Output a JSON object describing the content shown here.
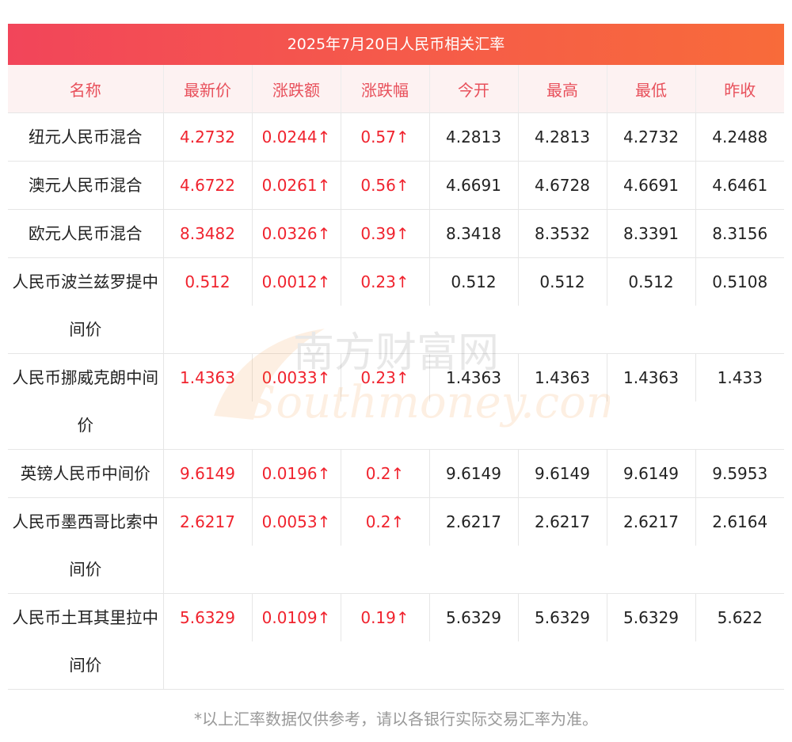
{
  "title": "2025年7月20日人民币相关汇率",
  "headers": [
    "名称",
    "最新价",
    "涨跌额",
    "涨跌幅",
    "今开",
    "最高",
    "最低",
    "昨收"
  ],
  "rows": [
    {
      "name": "纽元人民币混合",
      "latest": "4.2732",
      "change": "0.0244↑",
      "pct": "0.57↑",
      "open": "4.2813",
      "high": "4.2813",
      "low": "4.2732",
      "prev": "4.2488"
    },
    {
      "name": "澳元人民币混合",
      "latest": "4.6722",
      "change": "0.0261↑",
      "pct": "0.56↑",
      "open": "4.6691",
      "high": "4.6728",
      "low": "4.6691",
      "prev": "4.6461"
    },
    {
      "name": "欧元人民币混合",
      "latest": "8.3482",
      "change": "0.0326↑",
      "pct": "0.39↑",
      "open": "8.3418",
      "high": "8.3532",
      "low": "8.3391",
      "prev": "8.3156"
    },
    {
      "name": "人民币波兰兹罗提中间价",
      "latest": "0.512",
      "change": "0.0012↑",
      "pct": "0.23↑",
      "open": "0.512",
      "high": "0.512",
      "low": "0.512",
      "prev": "0.5108"
    },
    {
      "name": "人民币挪威克朗中间价",
      "latest": "1.4363",
      "change": "0.0033↑",
      "pct": "0.23↑",
      "open": "1.4363",
      "high": "1.4363",
      "low": "1.4363",
      "prev": "1.433"
    },
    {
      "name": "英镑人民币中间价",
      "latest": "9.6149",
      "change": "0.0196↑",
      "pct": "0.2↑",
      "open": "9.6149",
      "high": "9.6149",
      "low": "9.6149",
      "prev": "9.5953"
    },
    {
      "name": "人民币墨西哥比索中间价",
      "latest": "2.6217",
      "change": "0.0053↑",
      "pct": "0.2↑",
      "open": "2.6217",
      "high": "2.6217",
      "low": "2.6217",
      "prev": "2.6164"
    },
    {
      "name": "人民币土耳其里拉中间价",
      "latest": "5.6329",
      "change": "0.0109↑",
      "pct": "0.19↑",
      "open": "5.6329",
      "high": "5.6329",
      "low": "5.6329",
      "prev": "5.622"
    }
  ],
  "watermark": {
    "cn": "南方财富网",
    "en": "Southmoney.com"
  },
  "footer": "*以上汇率数据仅供参考，请以各银行实际交易汇率为准。",
  "colors": {
    "accent": "#f2455a",
    "up": "#f0232e",
    "header_text": "#e8505b"
  }
}
